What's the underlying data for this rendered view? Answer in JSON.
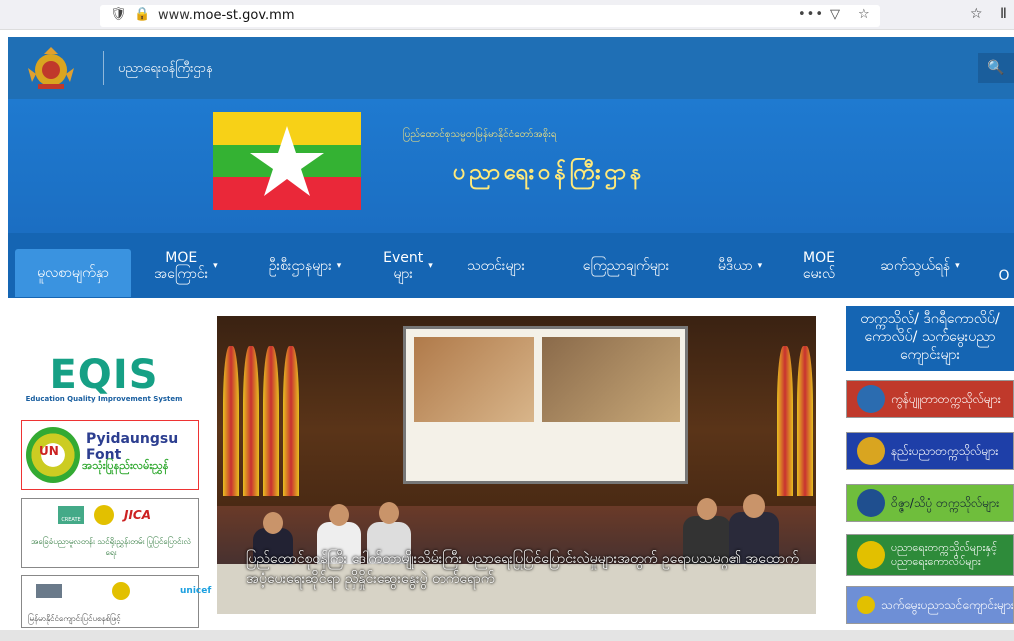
{
  "browser": {
    "url_prefix": "www.",
    "url_domain": "moe-st.gov.mm",
    "menu_glyph": "•••"
  },
  "site": {
    "name": "ပညာရေးဝန်ကြီးဌာန",
    "banner_small": "ပြည်ထောင်စုသမ္မတမြန်မာနိုင်ငံတော်အစိုးရ",
    "banner_big": "ပညာရေးဝန်ကြီးဌာန"
  },
  "nav": [
    {
      "label": "မူလစာမျက်နှာ",
      "caret": false
    },
    {
      "label": "MOE\nအကြောင်း",
      "caret": true
    },
    {
      "label": "ဦးစီးဌာနများ",
      "caret": true
    },
    {
      "label": "Event\nများ",
      "caret": true
    },
    {
      "label": "သတင်းများ",
      "caret": false
    },
    {
      "label": "ကြေညာချက်များ",
      "caret": false
    },
    {
      "label": "မီဒီယာ",
      "caret": true
    },
    {
      "label": "MOE\nမေးလ်",
      "caret": false
    },
    {
      "label": "ဆက်သွယ်ရန်",
      "caret": true
    },
    {
      "label": "O",
      "caret": false
    }
  ],
  "left": {
    "eqis_title": "EQIS",
    "eqis_sub": "Education Quality Improvement System",
    "pyidaungsu_title": "Pyidaungsu Font",
    "pyidaungsu_sub": "အသုံးပြုနည်းလမ်းညွှန်",
    "pyidaungsu_logo": "UN",
    "create_logo1": "CREATE",
    "create_logo3": "JICA",
    "create_text": "အခြေခံပညာမူလတန်း သင်ရိုးညွှန်းတမ်း ပြုပြင်ပြောင်းလဲရေး",
    "unicef_logo": "unicef",
    "unicef_text": "မြန်မာနိုင်ငံကျောင်းပြင်ပစနစ်ဖြင့်"
  },
  "slide": {
    "caption": "ပြည်ထောင်စုဝန်ကြီး ဒေါက်တာမျိုးသိမ်းကြီး ပညာရေးပြုပြင်ပြောင်းလဲမှုများအတွက် ဥရောပသမဂ္ဂ၏ အထောက်အပံ့ပေးရေးဆိုင်ရာ ညှိနှိုင်းဆွေးနွေးပွဲ တက်ရောက်"
  },
  "right": {
    "header": "တက္ကသိုလ်/ ဒီဂရီကောလိပ်/ ကောလိပ်/ သက်မွေးပညာကျောင်းများ",
    "buttons": [
      {
        "label": "ကွန်ပျူတာတက္ကသိုလ်များ",
        "bg": "#c0392b",
        "badge": "#2b6cb0"
      },
      {
        "label": "နည်းပညာတက္ကသိုလ်များ",
        "bg": "#1e3fa8",
        "badge": "#d9a520"
      },
      {
        "label": "ဝိဇ္ဇာ/သိပ္ပံ တက္ကသိုလ်များ",
        "bg": "#6fbe3c",
        "badge": "#1f4f8f"
      },
      {
        "label": "ပညာရေးတက္ကသိုလ်များနှင့် ပညာရေးကောလိပ်များ",
        "bg": "#2e8b3a",
        "badge": "#e2c000"
      },
      {
        "label": "သက်မွေးပညာသင်ကျောင်းများ",
        "bg": "#6e8fd6",
        "badge": "#e2c000"
      }
    ]
  },
  "colors": {
    "nav_bg": "#1565b3",
    "nav_active": "#3a93e0",
    "banner_text": "#ffe97a"
  }
}
